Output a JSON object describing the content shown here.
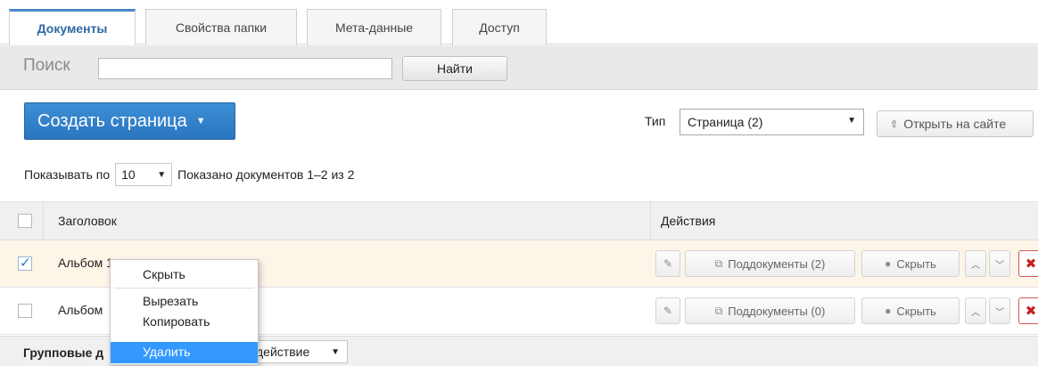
{
  "tabs": [
    {
      "label": "Документы",
      "active": true
    },
    {
      "label": "Свойства папки",
      "active": false
    },
    {
      "label": "Мета-данные",
      "active": false
    },
    {
      "label": "Доступ",
      "active": false
    }
  ],
  "search": {
    "label": "Поиск",
    "value": "",
    "button": "Найти"
  },
  "toolbar": {
    "create_button": "Создать страница",
    "type_label": "Тип",
    "type_value": "Страница (2)",
    "open_site_button": "Открыть на сайте"
  },
  "pagination": {
    "show_label": "Показывать по",
    "per_page": "10",
    "shown_text": "Показано документов 1–2 из 2"
  },
  "table": {
    "columns": [
      "Заголовок",
      "Действия"
    ],
    "rows": [
      {
        "title": "Альбом 1",
        "checked": true,
        "subdocs": "Поддокументы (2)",
        "hide": "Скрыть"
      },
      {
        "title": "Альбом",
        "checked": false,
        "subdocs": "Поддокументы (0)",
        "hide": "Скрыть"
      }
    ]
  },
  "group_actions": {
    "label": "Групповые д",
    "select_value": "действие"
  },
  "context_menu": {
    "items": [
      "Скрыть",
      "Вырезать",
      "Копировать",
      "Удалить"
    ],
    "highlighted": "Удалить"
  },
  "colors": {
    "accent": "#2a75bf",
    "highlight_row": "#fdf5e8",
    "menu_highlight": "#3399ff",
    "delete": "#c81e1e"
  }
}
